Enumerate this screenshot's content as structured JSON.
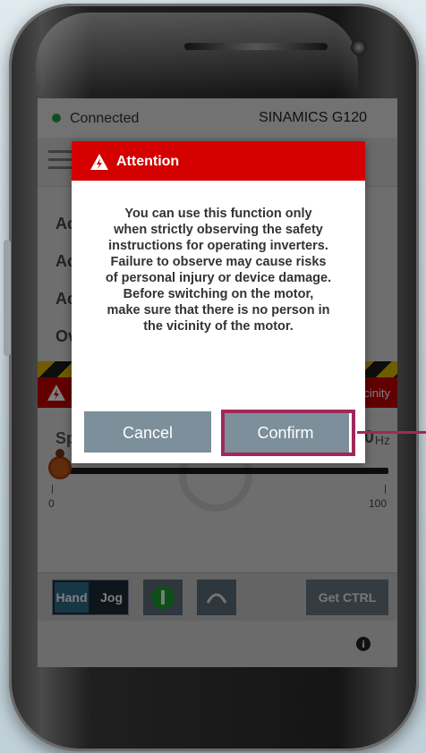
{
  "status": {
    "connection": "Connected",
    "device": "SINAMICS G120"
  },
  "menu_rows": [
    "Ac",
    "Ac",
    "Ac",
    "Ov"
  ],
  "warning_bar": {
    "text": "vicinity"
  },
  "speed": {
    "label": "Sp",
    "value": "0",
    "unit": "Hz"
  },
  "slider": {
    "min_label": "0",
    "max_label": "100",
    "value": 0
  },
  "controls": {
    "hand": "Hand",
    "jog": "Jog",
    "get_ctrl": "Get CTRL",
    "info": "i"
  },
  "dialog": {
    "title": "Attention",
    "lines": [
      "You can use this function only",
      "when strictly observing the safety",
      "instructions for operating inverters.",
      "Failure to observe may cause risks",
      "of personal injury or device damage.",
      "Before switching on the motor,",
      "make sure that there is no person in",
      "the vicinity of the motor."
    ],
    "cancel": "Cancel",
    "confirm": "Confirm"
  },
  "colors": {
    "header_red": "#d40000",
    "button": "#7c8f9b",
    "highlight": "#a0285a",
    "connected": "#1e9e3c"
  }
}
